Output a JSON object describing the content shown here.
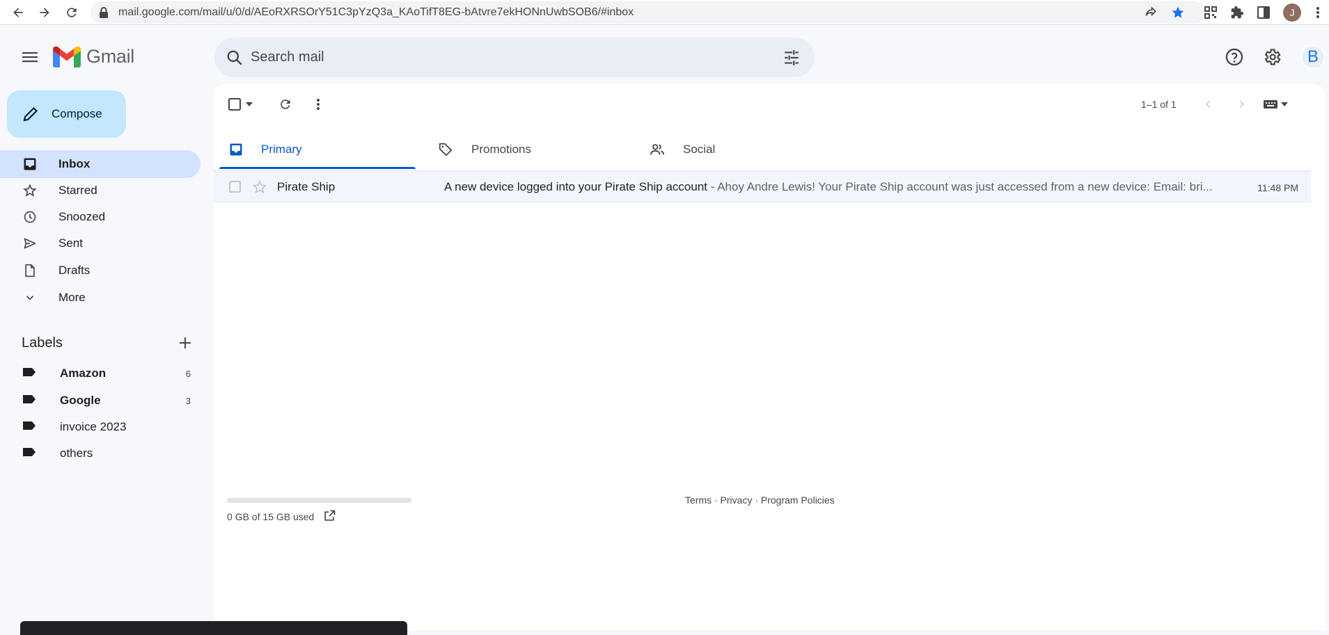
{
  "browser": {
    "url": "mail.google.com/mail/u/0/d/AEoRXRSOrY51C3pYzQ3a_KAoTifT8EG-bAtvre7ekHONnUwbSOB6/#inbox",
    "profile_initial": "J"
  },
  "header": {
    "app_name": "Gmail",
    "search_placeholder": "Search mail",
    "account_initial": "B"
  },
  "sidebar": {
    "compose_label": "Compose",
    "items": [
      {
        "label": "Inbox",
        "icon": "inbox-icon",
        "active": true
      },
      {
        "label": "Starred",
        "icon": "star-icon"
      },
      {
        "label": "Snoozed",
        "icon": "clock-icon"
      },
      {
        "label": "Sent",
        "icon": "send-icon"
      },
      {
        "label": "Drafts",
        "icon": "draft-icon"
      },
      {
        "label": "More",
        "icon": "chevron-down-icon"
      }
    ],
    "labels_title": "Labels",
    "labels": [
      {
        "name": "Amazon",
        "count": "6",
        "bold": true
      },
      {
        "name": "Google",
        "count": "3",
        "bold": true
      },
      {
        "name": "invoice 2023",
        "count": ""
      },
      {
        "name": "others",
        "count": ""
      }
    ]
  },
  "toolbar": {
    "pager": "1–1 of 1"
  },
  "tabs": [
    {
      "label": "Primary",
      "icon": "inbox-tab-icon",
      "active": true
    },
    {
      "label": "Promotions",
      "icon": "tag-icon"
    },
    {
      "label": "Social",
      "icon": "people-icon"
    }
  ],
  "emails": [
    {
      "sender": "Pirate Ship",
      "subject": "A new device logged into your Pirate Ship account",
      "preview": " - Ahoy Andre Lewis! Your Pirate Ship account was just accessed from a new device: Email: bri...",
      "time": "11:48 PM"
    }
  ],
  "footer": {
    "storage": "0 GB of 15 GB used",
    "links": "Terms · Privacy · Program Policies"
  },
  "colors": {
    "accent": "#0b57d0",
    "compose_bg": "#c2e7ff",
    "active_nav": "#d3e3fd",
    "page_bg": "#f6f8fc"
  }
}
